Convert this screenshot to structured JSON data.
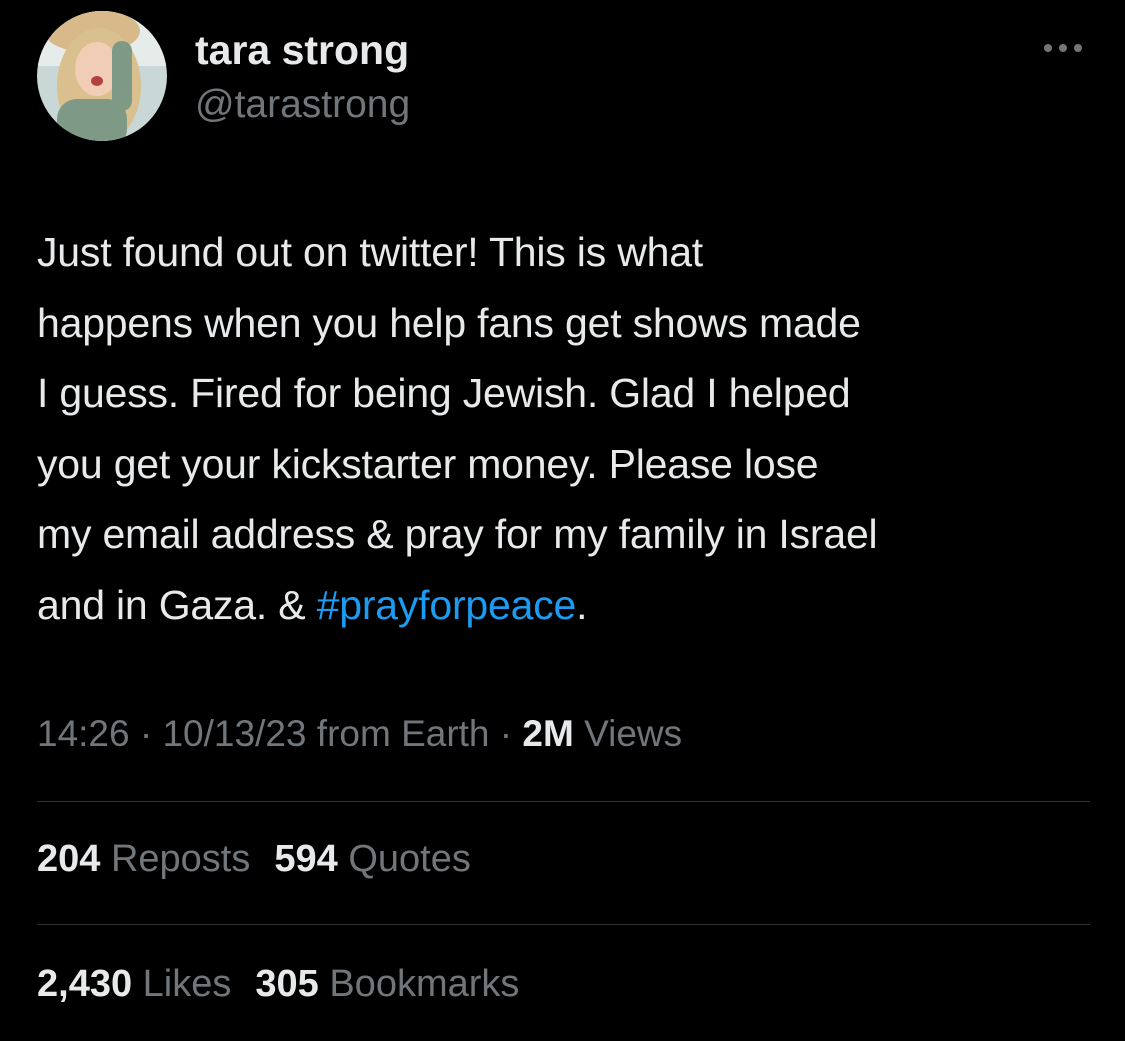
{
  "user": {
    "display_name": "tara strong",
    "handle": "@tarastrong"
  },
  "tweet": {
    "text": "Just found out on twitter! This is what\nhappens when you help fans get shows made\nI guess. Fired for being Jewish. Glad I helped\nyou get your kickstarter money. Please lose\nmy email address & pray for my family in Israel\nand in Gaza. & ",
    "hashtag": "#prayforpeace",
    "text_end": "."
  },
  "meta": {
    "time": "14:26",
    "sep1": " · ",
    "date": "10/13/23",
    "source": " from Earth",
    "sep2": " · ",
    "views_count": "2M",
    "views_label": " Views"
  },
  "stats": {
    "reposts_count": "204",
    "reposts_label": " Reposts",
    "quotes_count": "594",
    "quotes_label": " Quotes",
    "likes_count": "2,430",
    "likes_label": " Likes",
    "bookmarks_count": "305",
    "bookmarks_label": " Bookmarks"
  },
  "icons": {
    "more": "more-horizontal-icon"
  },
  "colors": {
    "background": "#000000",
    "primary_text": "#e7e9ea",
    "secondary_text": "#71767b",
    "link": "#1d9bf0",
    "divider": "#2f3336"
  }
}
